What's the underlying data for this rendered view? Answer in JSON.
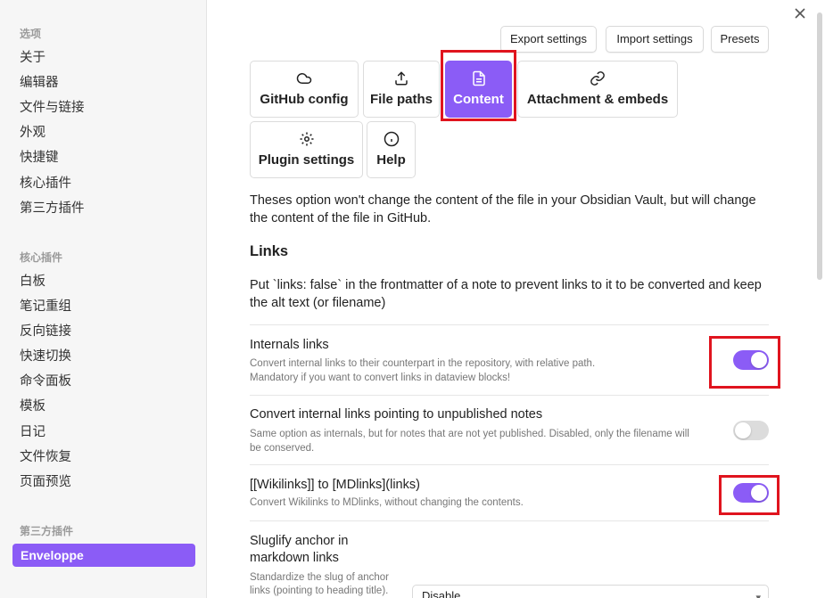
{
  "sidebar": {
    "section_options": "选项",
    "options": [
      "关于",
      "编辑器",
      "文件与链接",
      "外观",
      "快捷键",
      "核心插件",
      "第三方插件"
    ],
    "section_core": "核心插件",
    "core": [
      "白板",
      "笔记重组",
      "反向链接",
      "快速切换",
      "命令面板",
      "模板",
      "日记",
      "文件恢复",
      "页面预览"
    ],
    "section_third": "第三方插件",
    "active_plugin": "Enveloppe"
  },
  "toolbar": {
    "export": "Export settings",
    "import": "Import settings",
    "presets": "Presets"
  },
  "tabs": [
    {
      "label": "GitHub config",
      "icon": "cloud-icon"
    },
    {
      "label": "File paths",
      "icon": "upload-icon"
    },
    {
      "label": "Content",
      "icon": "file-text-icon"
    },
    {
      "label": "Attachment & embeds",
      "icon": "link-icon"
    },
    {
      "label": "Plugin settings",
      "icon": "gear-icon"
    },
    {
      "label": "Help",
      "icon": "info-icon"
    }
  ],
  "content": {
    "intro": "Theses option won't change the content of the file in your Obsidian Vault, but will change the content of the file in GitHub.",
    "links_title": "Links",
    "links_desc": "Put `links: false` in the frontmatter of a note to prevent links to it to be converted and keep the alt text (or filename)",
    "settings": [
      {
        "name": "Internals links",
        "desc1": "Convert internal links to their counterpart in the repository, with relative path.",
        "desc2": "Mandatory if you want to convert links in dataview blocks!",
        "enabled": true
      },
      {
        "name": "Convert internal links pointing to unpublished notes",
        "desc1": "Same option as internals, but for notes that are not yet published. Disabled, only the filename will",
        "desc2": "be conserved.",
        "enabled": false
      },
      {
        "name": "[[Wikilinks]] to [MDlinks](links)",
        "desc1": "Convert Wikilinks to MDlinks, without changing the contents.",
        "enabled": true
      },
      {
        "name1": "Sluglify anchor in",
        "name2": "markdown links",
        "desc1": "Standardize the slug of anchor",
        "desc2": "links (pointing to heading title).",
        "dropdown": "Disable"
      }
    ]
  },
  "colors": {
    "accent": "#8b5cf6",
    "highlight": "#e0141e"
  }
}
